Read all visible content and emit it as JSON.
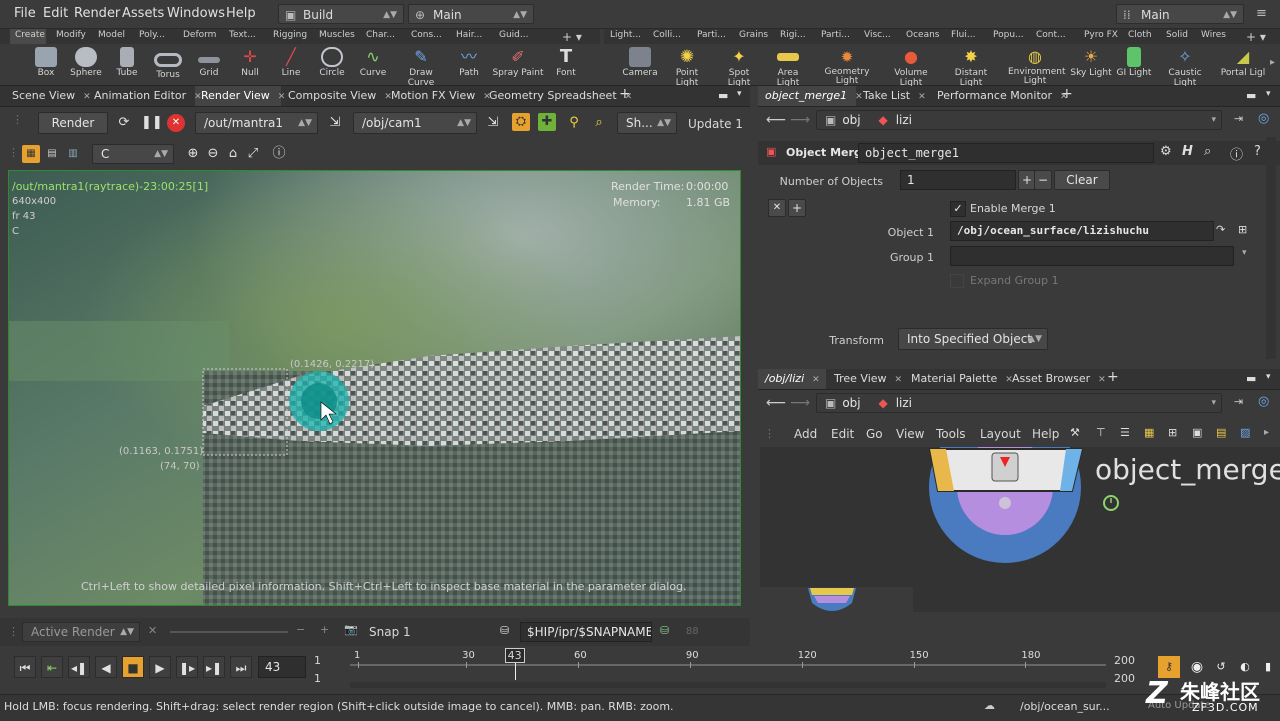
{
  "menu": {
    "items": [
      "File",
      "Edit",
      "Render",
      "Assets",
      "Windows",
      "Help"
    ],
    "desktop_left": "Build",
    "desktop_center": "Main",
    "desktop_right": "Main"
  },
  "shelf_left": {
    "tabs": [
      "Create",
      "Modify",
      "Model",
      "Poly...",
      "Deform",
      "Text...",
      "Rigging",
      "Muscles",
      "Char...",
      "Cons...",
      "Hair...",
      "Guid..."
    ],
    "tools": [
      "Box",
      "Sphere",
      "Tube",
      "Torus",
      "Grid",
      "Null",
      "Line",
      "Circle",
      "Curve",
      "Draw Curve",
      "Path",
      "Spray Paint",
      "Font"
    ]
  },
  "shelf_right": {
    "tabs": [
      "Light...",
      "Colli...",
      "Parti...",
      "Grains",
      "Rigi...",
      "Parti...",
      "Visc...",
      "Oceans",
      "Flui...",
      "Popu...",
      "Cont...",
      "Pyro FX",
      "Cloth",
      "Solid",
      "Wires"
    ],
    "tools": [
      "Camera",
      "Point Light",
      "Spot Light",
      "Area Light",
      "Geometry Light",
      "Volume Light",
      "Distant Light",
      "Environment Light",
      "Sky Light",
      "GI Light",
      "Caustic Light",
      "Portal Ligl"
    ]
  },
  "left_pane_tabs": [
    "Scene View",
    "Animation Editor",
    "Render View",
    "Composite View",
    "Motion FX View",
    "Geometry Spreadsheet"
  ],
  "render_toolbar": {
    "render_label": "Render",
    "out_path": "/out/mantra1",
    "camera": "/obj/cam1",
    "shade_label": "Sh...",
    "update_label": "Update 1"
  },
  "viewport_toolbar": {
    "channel": "C"
  },
  "render_info": {
    "title": "/out/mantra1(raytrace)-23:00:25[1]",
    "res": "640x400",
    "frame": "fr 43",
    "channel": "C",
    "render_time_label": "Render Time:",
    "render_time": "0:00:00",
    "memory_label": "Memory:",
    "memory": "1.81 GB",
    "coord_top": "(0.1426, 0.2217)",
    "coord_bottom": "(0.1163, 0.1751)",
    "pixel_bottom": "(74, 70)",
    "hint": "Ctrl+Left to show detailed pixel information. Shift+Ctrl+Left to inspect base material in the parameter dialog."
  },
  "render_bottom": {
    "active_render": "Active Render",
    "snap": "Snap 1",
    "path": "$HIP/ipr/$SNAPNAME",
    "count": "88"
  },
  "right_top_tabs": [
    "object_merge1",
    "Take List",
    "Performance Monitor"
  ],
  "path_bar_top": {
    "root": "obj",
    "node": "lizi"
  },
  "params": {
    "node_type": "Object Merge",
    "node_name": "object_merge1",
    "num_objects_label": "Number of Objects",
    "num_objects": "1",
    "clear": "Clear",
    "enable_merge": "Enable Merge 1",
    "object1_label": "Object 1",
    "object1": "/obj/ocean_surface/lizishuchu",
    "group1_label": "Group 1",
    "group1": "",
    "expand_group": "Expand Group 1",
    "transform_label": "Transform",
    "transform": "Into Specified Object"
  },
  "right_bottom_tabs": [
    "/obj/lizi",
    "Tree View",
    "Material Palette",
    "Asset Browser"
  ],
  "path_bar_bottom": {
    "root": "obj",
    "node": "lizi"
  },
  "network_menu": [
    "Add",
    "Edit",
    "Go",
    "View",
    "Tools",
    "Layout",
    "Help"
  ],
  "network_node_label": "object_merge",
  "timeline": {
    "current_frame": "43",
    "start": "1",
    "start2": "1",
    "end": "200",
    "end2": "200",
    "ticks": [
      "1",
      "30",
      "60",
      "90",
      "120",
      "150",
      "180"
    ],
    "marker": "43",
    "range_start": 1,
    "range_end": 200
  },
  "status": {
    "text": "Hold LMB: focus rendering. Shift+drag: select render region (Shift+click outside image to cancel). MMB: pan. RMB: zoom.",
    "path": "/obj/ocean_sur...",
    "auto_update": "Auto Update"
  },
  "watermark": {
    "text": "朱峰社区",
    "sub": "ZF3D.COM"
  },
  "colors": {
    "accent_green": "#2f8a2f",
    "render_info": "#9be36b",
    "node_blue": "#4a7bc0",
    "node_purple": "#b58ee0"
  }
}
